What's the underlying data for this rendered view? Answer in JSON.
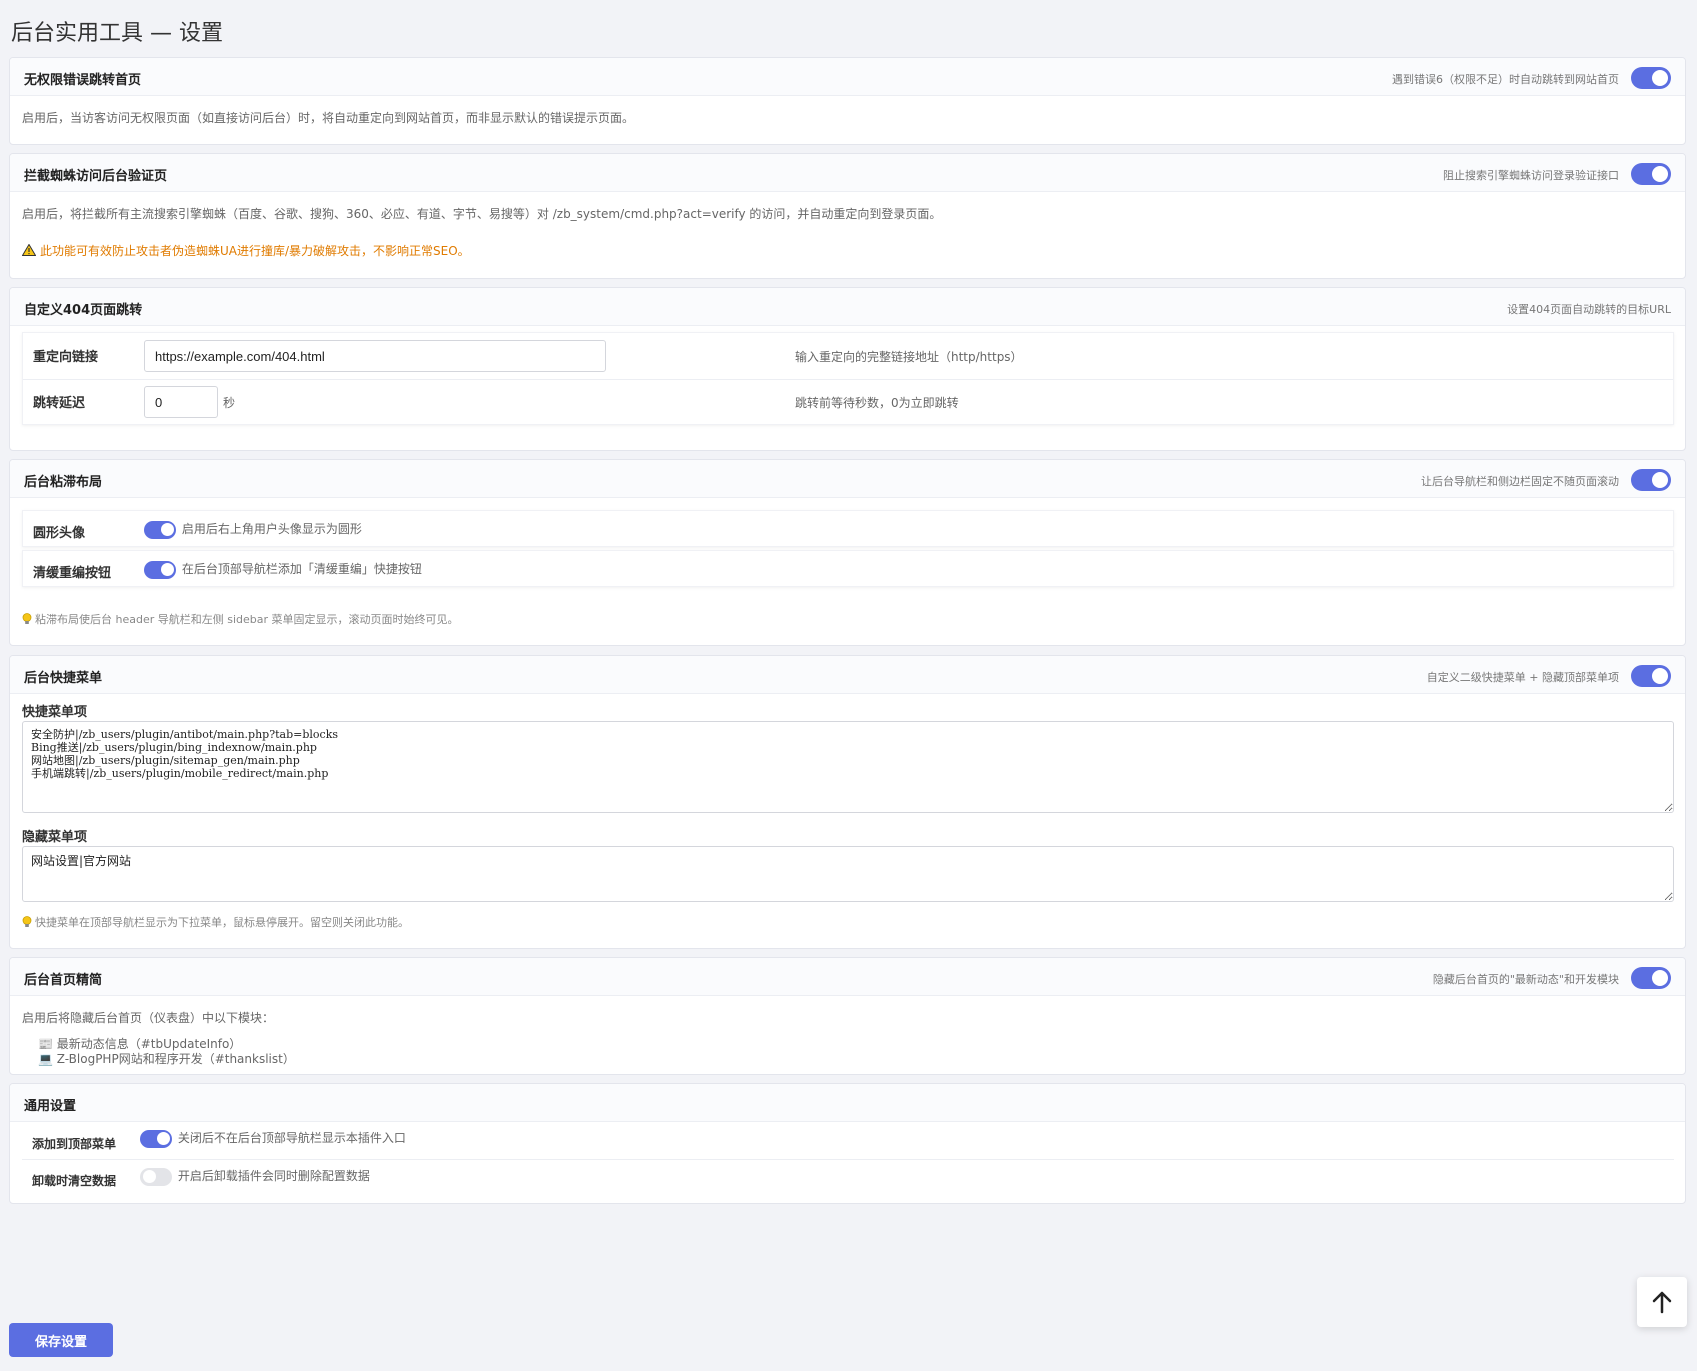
{
  "page": {
    "title": "后台实用工具 — 设置"
  },
  "colors": {
    "accent": "#5b6ee1",
    "warning": "#e07b00",
    "background": "#f2f3f7"
  },
  "sections": {
    "no_permission": {
      "title": "无权限错误跳转首页",
      "hint": "遇到错误6（权限不足）时自动跳转到网站首页",
      "enabled": true,
      "desc": "启用后，当访客访问无权限页面（如直接访问后台）时，将自动重定向到网站首页，而非显示默认的错误提示页面。"
    },
    "block_spider": {
      "title": "拦截蜘蛛访问后台验证页",
      "hint": "阻止搜索引擎蜘蛛访问登录验证接口",
      "enabled": true,
      "desc": "启用后，将拦截所有主流搜索引擎蜘蛛（百度、谷歌、搜狗、360、必应、有道、字节、易搜等）对 /zb_system/cmd.php?act=verify 的访问，并自动重定向到登录页面。",
      "warning": "此功能可有效防止攻击者伪造蜘蛛UA进行撞库/暴力破解攻击，不影响正常SEO。"
    },
    "custom_404": {
      "title": "自定义404页面跳转",
      "hint": "设置404页面自动跳转的目标URL",
      "redirect_label": "重定向链接",
      "redirect_value": "https://example.com/404.html",
      "redirect_help": "输入重定向的完整链接地址（http/https）",
      "delay_label": "跳转延迟",
      "delay_value": "0",
      "delay_unit": "秒",
      "delay_help": "跳转前等待秒数，0为立即跳转"
    },
    "sticky_layout": {
      "title": "后台粘滞布局",
      "hint": "让后台导航栏和侧边栏固定不随页面滚动",
      "enabled": true,
      "avatar_label": "圆形头像",
      "avatar_enabled": true,
      "avatar_help": "启用后右上角用户头像显示为圆形",
      "rebuild_label": "清缓重编按钮",
      "rebuild_enabled": true,
      "rebuild_help": "在后台顶部导航栏添加「清缓重编」快捷按钮",
      "tip": "粘滞布局使后台 header 导航栏和左侧 sidebar 菜单固定显示，滚动页面时始终可见。"
    },
    "quick_menu": {
      "title": "后台快捷菜单",
      "hint": "自定义二级快捷菜单 + 隐藏顶部菜单项",
      "enabled": true,
      "items_label": "快捷菜单项",
      "items_value": "安全防护|/zb_users/plugin/antibot/main.php?tab=blocks\nBing推送|/zb_users/plugin/bing_indexnow/main.php\n网站地图|/zb_users/plugin/sitemap_gen/main.php\n手机端跳转|/zb_users/plugin/mobile_redirect/main.php",
      "hidden_label": "隐藏菜单项",
      "hidden_value": "网站设置|官方网站",
      "tip": "快捷菜单在顶部导航栏显示为下拉菜单，鼠标悬停展开。留空则关闭此功能。"
    },
    "dashboard_slim": {
      "title": "后台首页精简",
      "hint": "隐藏后台首页的\"最新动态\"和开发模块",
      "enabled": true,
      "desc": "启用后将隐藏后台首页（仪表盘）中以下模块：",
      "modules": [
        "📰 最新动态信息（#tbUpdateInfo）",
        "💻 Z-BlogPHP网站和程序开发（#thankslist）"
      ]
    },
    "general": {
      "title": "通用设置",
      "topmenu_label": "添加到顶部菜单",
      "topmenu_enabled": true,
      "topmenu_help": "关闭后不在后台顶部导航栏显示本插件入口",
      "uninstall_label": "卸载时清空数据",
      "uninstall_enabled": false,
      "uninstall_help": "开启后卸载插件会同时删除配置数据"
    }
  },
  "actions": {
    "save_label": "保存设置"
  },
  "icons": {
    "scroll_top": "arrow-up-icon",
    "warning": "warning-icon",
    "tip": "lightbulb-icon"
  }
}
